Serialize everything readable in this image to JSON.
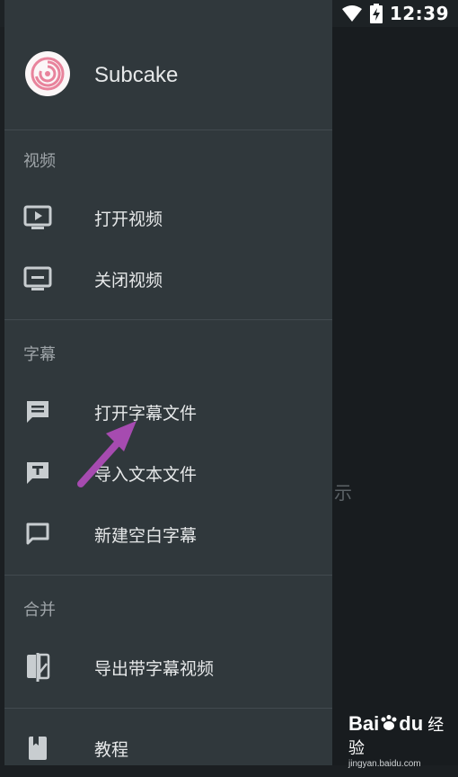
{
  "status_bar": {
    "time": "12:39",
    "icons": [
      "wifi-icon",
      "battery-charging-icon"
    ]
  },
  "app": {
    "name": "Subcake",
    "logo_icon": "swirl-logo"
  },
  "sections": {
    "video": {
      "title": "视频",
      "items": [
        {
          "label": "打开视频",
          "icon": "play-screen-icon"
        },
        {
          "label": "关闭视频",
          "icon": "monitor-minus-icon"
        }
      ]
    },
    "subtitle": {
      "title": "字幕",
      "items": [
        {
          "label": "打开字幕文件",
          "icon": "message-lines-icon"
        },
        {
          "label": "导入文本文件",
          "icon": "message-text-icon"
        },
        {
          "label": "新建空白字幕",
          "icon": "message-empty-icon"
        }
      ]
    },
    "merge": {
      "title": "合并",
      "items": [
        {
          "label": "导出带字幕视频",
          "icon": "compare-icon"
        }
      ]
    },
    "help": {
      "items": [
        {
          "label": "教程",
          "icon": "book-icon"
        }
      ]
    }
  },
  "background": {
    "partial_text": "示"
  },
  "watermark": {
    "logo_text": "Bai",
    "logo_text2": "du",
    "brand": "经验",
    "url": "jingyan.baidu.com"
  },
  "colors": {
    "drawer_bg": "#30383c",
    "text_primary": "#e6e8e9",
    "text_secondary": "#9ea4a8",
    "icon": "#c8cdd0",
    "annotation_arrow": "#a64bb0"
  }
}
